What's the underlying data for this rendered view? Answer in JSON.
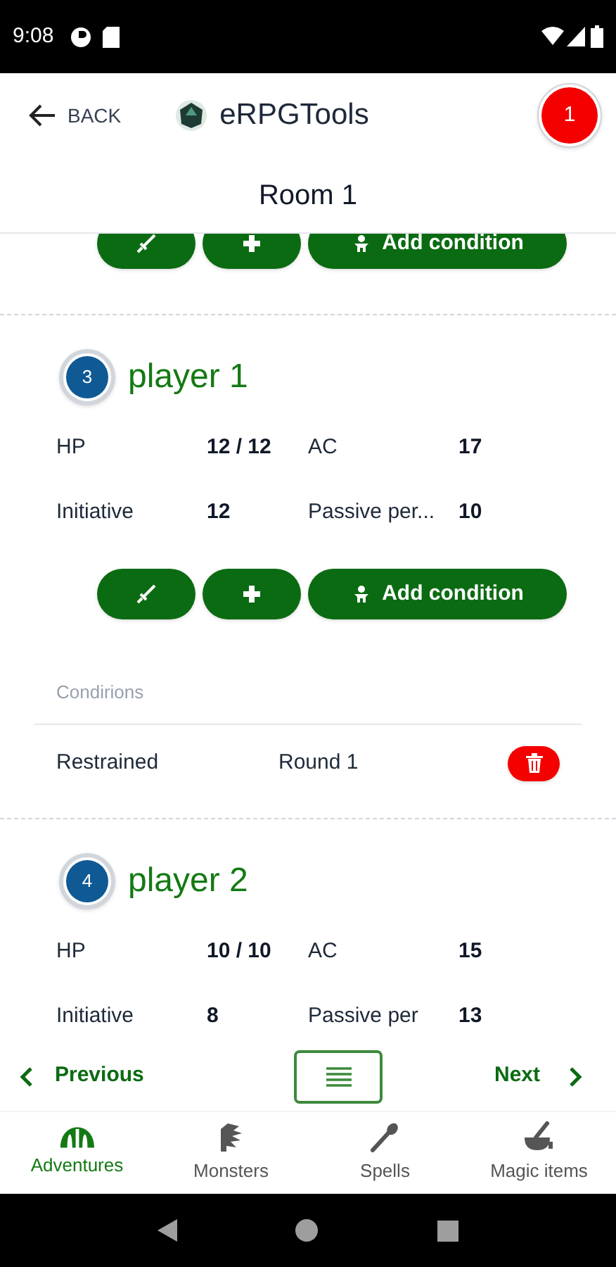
{
  "status_bar": {
    "time": "9:08"
  },
  "app_bar": {
    "back": "BACK",
    "title": "eRPGTools",
    "badge": "1"
  },
  "room_title": "Room 1",
  "previous_card": {
    "buttons": [
      {
        "kind": "attack"
      },
      {
        "kind": "heal"
      },
      {
        "kind": "condition",
        "label": "Add condition"
      }
    ]
  },
  "players": [
    {
      "number": "3",
      "name": "player 1",
      "stats": [
        {
          "label": "HP",
          "value": "12 / 12"
        },
        {
          "label": "AC",
          "value": "17"
        },
        {
          "label": "Initiative",
          "value": "12"
        },
        {
          "label": "Passive per...",
          "value": "10"
        }
      ],
      "buttons": [
        {
          "kind": "attack"
        },
        {
          "kind": "heal"
        },
        {
          "kind": "condition",
          "label": "Add condition"
        }
      ],
      "conditions": {
        "header": "Condirions",
        "rows": [
          {
            "name": "Restrained",
            "round": "Round 1"
          }
        ]
      }
    },
    {
      "number": "4",
      "name": "player 2",
      "stats": [
        {
          "label": "HP",
          "value": "10 / 10"
        },
        {
          "label": "AC",
          "value": "15"
        },
        {
          "label": "Initiative",
          "value": "8"
        },
        {
          "label": "Passive per",
          "value": "13"
        }
      ]
    }
  ],
  "pager": {
    "previous": "Previous",
    "next": "Next"
  },
  "tabs": [
    {
      "kind": "adventures",
      "label": "Adventures",
      "selected": true
    },
    {
      "kind": "monsters",
      "label": "Monsters",
      "selected": false
    },
    {
      "kind": "spells",
      "label": "Spells",
      "selected": false
    },
    {
      "kind": "magic",
      "label": "Magic items",
      "selected": false
    }
  ]
}
